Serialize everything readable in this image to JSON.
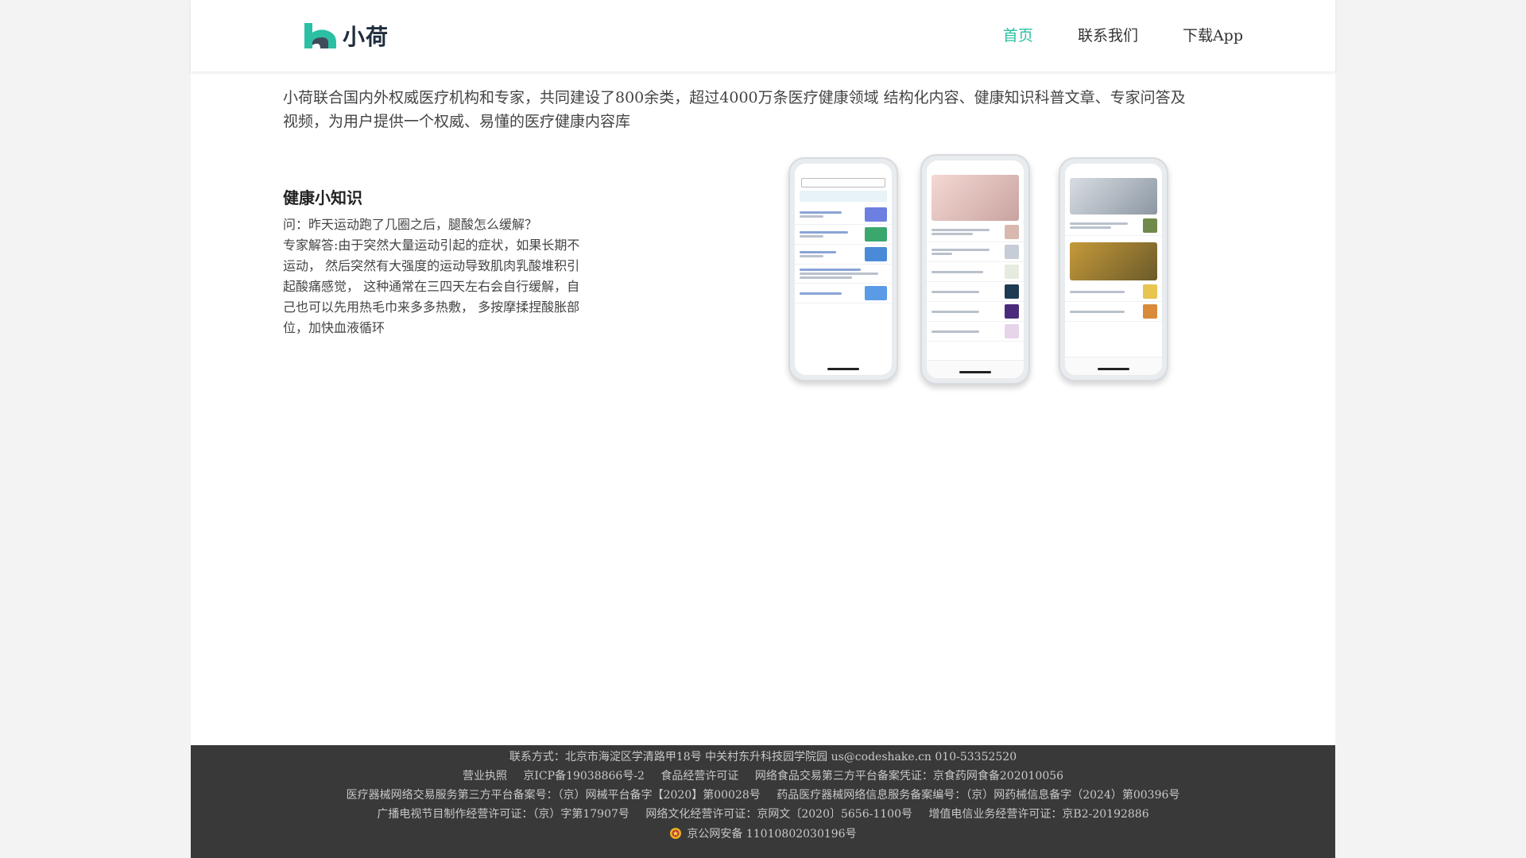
{
  "header": {
    "logo_text": "小荷",
    "nav": [
      {
        "label": "首页",
        "active": true
      },
      {
        "label": "联系我们",
        "active": false
      },
      {
        "label": "下载App",
        "active": false
      }
    ]
  },
  "colors": {
    "accent": "#2bbfa4",
    "footer_bg": "#393939",
    "page_bg": "#f3f3f3"
  },
  "intro": "小荷联合国内外权威医疗机构和专家，共同建设了800余类，超过4000万条医疗健康领域 结构化内容、健康知识科普文章、专家问答及视频，为用户提供一个权威、易懂的医疗健康内容库",
  "knowledge": {
    "title": "健康小知识",
    "question": "问：昨天运动跑了几圈之后，腿酸怎么缓解？",
    "answer": "专家解答:由于突然大量运动引起的症状，如果长期不运动， 然后突然有大强度的运动导致肌肉乳酸堆积引起酸痛感觉， 这种通常在三四天左右会自行缓解，自己也可以先用热毛巾来多多热敷， 多按摩揉捏酸胀部位，加快血液循环"
  },
  "footer": {
    "line1": "联系方式：北京市海淀区学清路甲18号 中关村东升科技园学院园  us@codeshake.cn  010-53352520",
    "line2": [
      "营业执照",
      "京ICP备19038866号-2",
      "食品经营许可证",
      "网络食品交易第三方平台备案凭证：京食药网食备202010056"
    ],
    "line3": [
      "医疗器械网络交易服务第三方平台备案号：（京）网械平台备字【2020】第00028号",
      "药品医疗器械网络信息服务备案编号：（京）网药械信息备字（2024）第00396号"
    ],
    "line4": [
      "广播电视节目制作经营许可证：（京）字第17907号",
      "网络文化经营许可证：京网文〔2020〕5656-1100号",
      "增值电信业务经营许可证：京B2-20192886"
    ],
    "police": "京公网安备 11010802030196号",
    "police_icon": "police-badge-icon"
  }
}
